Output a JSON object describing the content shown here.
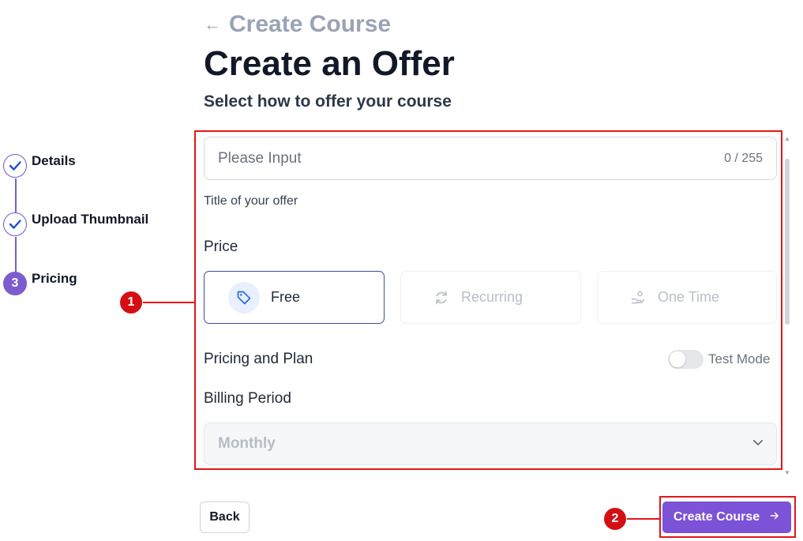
{
  "header": {
    "back_label": "Create Course",
    "title": "Create an Offer",
    "subtitle": "Select how to offer your course"
  },
  "stepper": {
    "steps": [
      {
        "label": "Details",
        "state": "done"
      },
      {
        "label": "Upload Thumbnail",
        "state": "done"
      },
      {
        "label": "Pricing",
        "state": "active",
        "number": "3"
      }
    ]
  },
  "form": {
    "title_input": {
      "placeholder": "Please Input",
      "value": "",
      "counter": "0 / 255"
    },
    "title_help": "Title of your offer",
    "price_label": "Price",
    "price_options": [
      {
        "label": "Free",
        "icon": "tag-icon",
        "selected": true
      },
      {
        "label": "Recurring",
        "icon": "refresh-icon",
        "selected": false
      },
      {
        "label": "One Time",
        "icon": "hand-coins-icon",
        "selected": false
      }
    ],
    "pricing_plan_label": "Pricing and Plan",
    "test_mode": {
      "label": "Test Mode",
      "enabled": false
    },
    "billing_period_label": "Billing Period",
    "billing_period_value": "Monthly"
  },
  "footer": {
    "back_button": "Back",
    "create_button": "Create Course"
  },
  "annotations": {
    "badge_1": "1",
    "badge_2": "2"
  },
  "colors": {
    "accent": "#7c52d6",
    "highlight": "#e0161a",
    "selected_border": "#3b4fa0"
  }
}
